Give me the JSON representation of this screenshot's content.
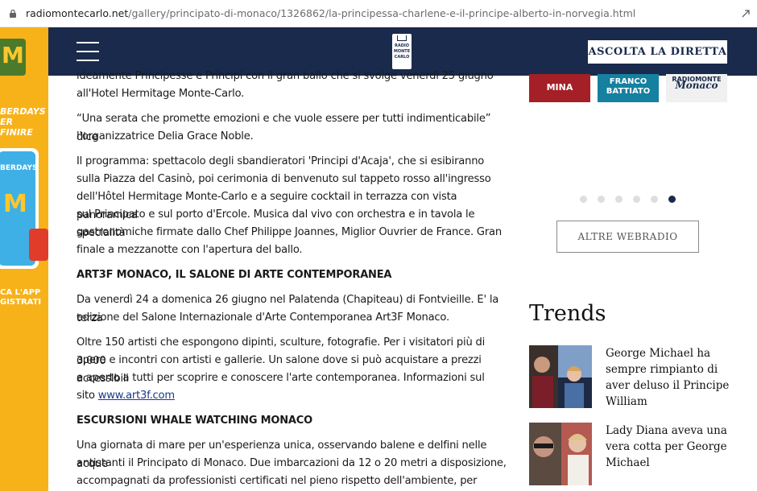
{
  "browser": {
    "url_domain": "radiomontecarlo.net",
    "url_path": "/gallery/principato-di-monaco/1326862/la-principessa-charlene-e-il-principe-alberto-in-norvegia.html"
  },
  "ad": {
    "brand_letter": "M",
    "text_top": "BERDAYS\nER FINIRE",
    "phone_text": "BERDAYS",
    "phone_letter": "M",
    "text_bottom": "CA L'APP\nGISTRATI",
    "colors": {
      "bg": "#f7b21a",
      "logo_bg": "#4b7a2b",
      "fries": "#e13b2a"
    }
  },
  "header": {
    "listen_button": "ASCOLTA LA DIRETTA",
    "logo_lines": [
      "RADIO",
      "MONTE",
      "CARLO"
    ],
    "color": "#1a2a4c"
  },
  "article": {
    "paragraphs": [
      "ideamente Principesse e Principi con il gran ballo che si svolge venerdì 25 giugno",
      "all'Hotel Hermitage Monte-Carlo.",
      "“Una serata che promette emozioni e che vuole essere per tutti indimenticabile” dice",
      "l'organizzatrice Delia Grace Noble.",
      "Il programma: spettacolo degli sbandieratori 'Principi d'Acaja', che si esibiranno",
      "sulla Piazza del Casinò, poi cerimonia di benvenuto sul tappeto rosso all'ingresso",
      "dell'Hôtel Hermitage Monte-Carlo e a seguire cocktail in terrazza con vista panoramica",
      "sul Principato e sul porto d'Ercole. Musica dal vivo con orchestra e in tavola le specialità",
      "gastronomiche firmate dallo Chef Philippe Joannes, Miglior Ouvrier de France. Gran",
      "finale a mezzanotte con l'apertura del ballo.",
      "Da venerdì 24 a domenica 26 giugno nel Palatenda (Chapiteau) di Fontvieille. E' la terza",
      "edizione del Salone Internazionale d'Arte Contemporanea Art3F Monaco.",
      "Oltre 150 artisti che espongono dipinti, sculture, fotografie. Per i visitatori più di 3.000",
      "opere e incontri con artisti e gallerie. Un salone dove si può acquistare a prezzi accessibili",
      "e aperto a tutti per scoprire e conoscere l'arte contemporanea. Informazioni sul",
      "sito ",
      "Una giornata di mare per un'esperienza unica, osservando balene e delfini nelle acque",
      "antistanti il Principato di Monaco. Due imbarcazioni da 12 o 20 metri a disposizione,",
      "accompagnati da professionisti certificati nel pieno rispetto dell'ambiente, per scoprire i"
    ],
    "heading1": "ART3F MONACO, IL SALONE DI ARTE CONTEMPORANEA",
    "heading2": "ESCURSIONI WHALE WATCHING MONACO",
    "link_text": "www.art3f.com "
  },
  "sidebar": {
    "tiles": [
      {
        "label": "MINA",
        "color": "#a42026"
      },
      {
        "label": "FRANCO\nBATTIATO",
        "color": "#1580a0"
      },
      {
        "label": "RADIOMONTE",
        "label2": "Monaco",
        "color": "#f0f0f0"
      }
    ],
    "carousel_dots": 6,
    "carousel_active": 6,
    "webradio_button": "ALTRE WEBRADIO",
    "trends_title": "Trends",
    "trends": [
      {
        "headline": "George Michael ha sempre rimpianto di aver deluso il Principe William"
      },
      {
        "headline": "Lady Diana aveva una vera cotta per George Michael"
      }
    ]
  }
}
